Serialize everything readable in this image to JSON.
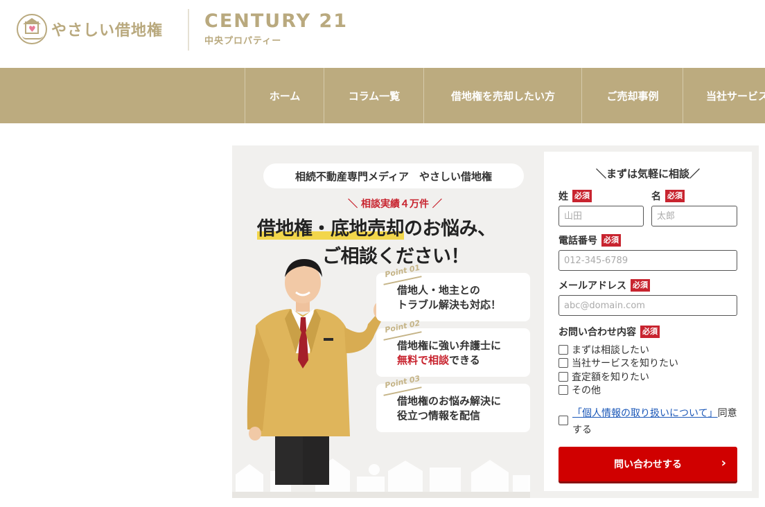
{
  "header": {
    "logo_text": "やさしい借地権",
    "brand_title": "CENTURY 21",
    "brand_sub": "中央プロパティー"
  },
  "nav": {
    "items": [
      {
        "label": "ホーム"
      },
      {
        "label": "コラム一覧"
      },
      {
        "label": "借地権を売却したい方"
      },
      {
        "label": "ご売却事例"
      },
      {
        "label": "当社サービス"
      }
    ]
  },
  "banner": {
    "pill": "相続不動産専門メディア　やさしい借地権",
    "achievement": "＼ 相談実績４万件 ／",
    "headline_highlight": "借地権・底地売却",
    "headline_rest": "のお悩み、",
    "headline_line2": "ご相談ください！",
    "points": [
      {
        "tag": "Point 01",
        "line1": "借地人・地主との",
        "line2": "トラブル解決も対応！"
      },
      {
        "tag": "Point 02",
        "line1": "借地権に強い弁護士に",
        "line2_red": "無料で相談",
        "line2_rest": "できる"
      },
      {
        "tag": "Point 03",
        "line1": "借地権のお悩み解決に",
        "line2": "役立つ情報を配信"
      }
    ]
  },
  "form": {
    "title": "＼まずは気軽に相談／",
    "required": "必須",
    "last_name_label": "姓",
    "last_name_placeholder": "山田",
    "first_name_label": "名",
    "first_name_placeholder": "太郎",
    "phone_label": "電話番号",
    "phone_placeholder": "012-345-6789",
    "email_label": "メールアドレス",
    "email_placeholder": "abc@domain.com",
    "inquiry_label": "お問い合わせ内容",
    "options": [
      {
        "label": "まずは相談したい"
      },
      {
        "label": "当社サービスを知りたい"
      },
      {
        "label": "査定額を知りたい"
      },
      {
        "label": "その他"
      }
    ],
    "privacy_link": "「個人情報の取り扱いについて」",
    "privacy_agree": "同意する",
    "submit_label": "問い合わせする"
  },
  "colors": {
    "gold": "#bcab7f",
    "red": "#c8242f",
    "submit": "#d00000"
  }
}
